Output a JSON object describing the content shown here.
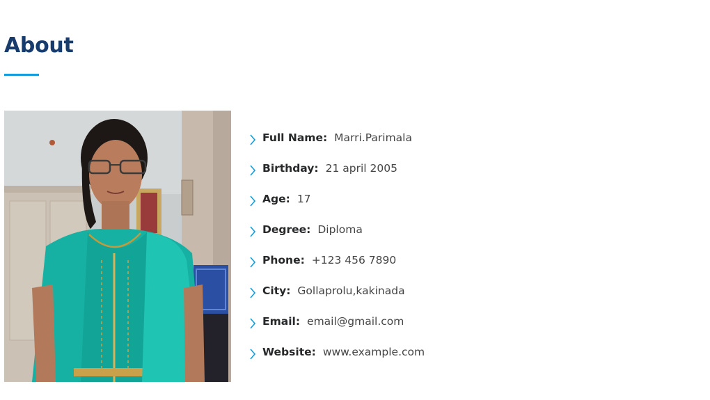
{
  "about": {
    "title": "About"
  },
  "colors": {
    "heading": "#173b6c",
    "accent": "#149ddd",
    "text": "#272829"
  },
  "profile": {
    "photo_icon": "portrait-photo",
    "chevron_icon": "chevron-right-icon",
    "fields": [
      {
        "key": "Full Name:",
        "value": "Marri.Parimala"
      },
      {
        "key": "Birthday:",
        "value": "21 april 2005"
      },
      {
        "key": "Age:",
        "value": "17"
      },
      {
        "key": "Degree:",
        "value": "Diploma"
      },
      {
        "key": "Phone:",
        "value": "+123 456 7890"
      },
      {
        "key": "City:",
        "value": "Gollaprolu,kakinada"
      },
      {
        "key": "Email:",
        "value": "email@gmail.com"
      },
      {
        "key": "Website:",
        "value": "www.example.com"
      }
    ]
  }
}
